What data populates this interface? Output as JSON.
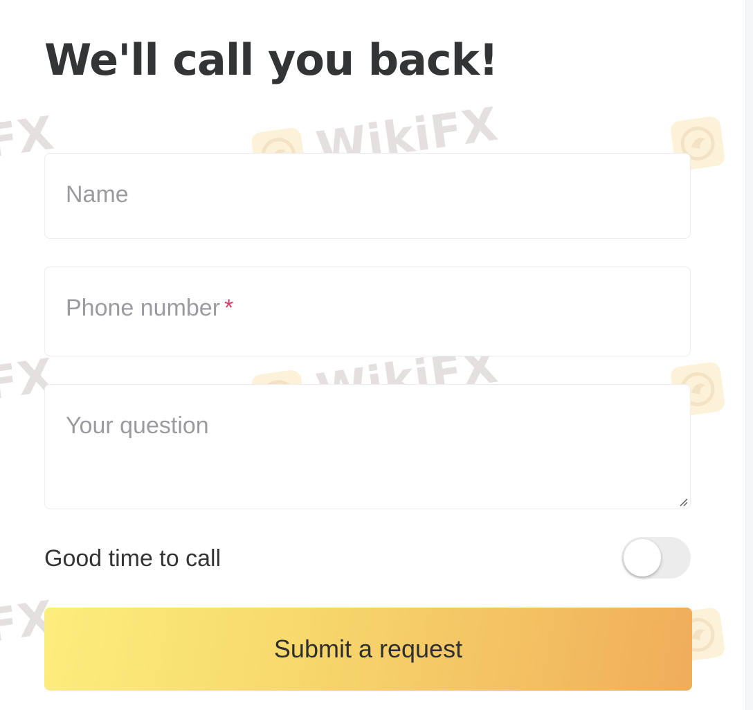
{
  "form": {
    "title": "We'll call you back!",
    "name_placeholder": "Name",
    "phone_placeholder": "Phone number",
    "phone_required_mark": "*",
    "question_placeholder": "Your question",
    "good_time_label": "Good time to call",
    "good_time_enabled": false,
    "submit_label": "Submit a request"
  },
  "watermark": {
    "text": "WikiFX",
    "partial_text": "FX"
  },
  "colors": {
    "title": "#333436",
    "placeholder": "#9a9b9e",
    "required": "#d6416b",
    "button_gradient_start": "#fcee7e",
    "button_gradient_end": "#f0ad5a"
  }
}
